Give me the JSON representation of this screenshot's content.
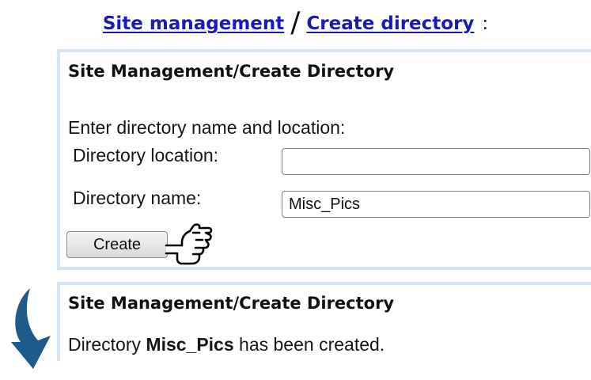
{
  "breadcrumb": {
    "link1": "Site management",
    "separator": "/",
    "link2": "Create directory",
    "trailing": ":"
  },
  "form_panel": {
    "title": "Site Management/Create Directory",
    "intro": "Enter directory name and location:",
    "location_label": "Directory location:",
    "location_value": "",
    "name_label": "Directory name:",
    "name_value": "Misc_Pics",
    "create_button": "Create",
    "pointer_icon": "pointing-hand-icon"
  },
  "result_panel": {
    "title": "Site Management/Create Directory",
    "message_prefix": "Directory",
    "directory_name": "Misc_Pics",
    "message_suffix": "has been created.",
    "arrow_icon": "curved-arrow-down-icon"
  },
  "colors": {
    "link": "#1a1ab4",
    "panel_border": "#d5e4f3",
    "arrow": "#1f5a8c"
  }
}
